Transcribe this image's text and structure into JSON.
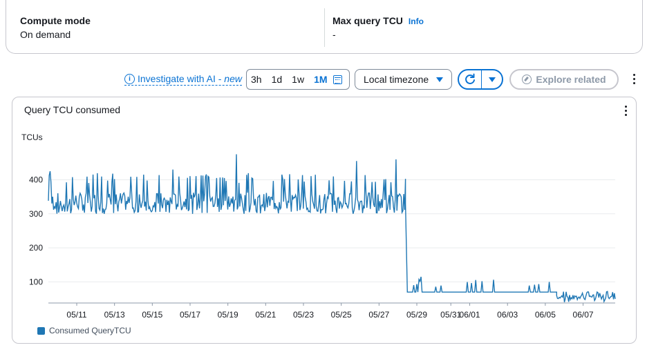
{
  "summary": {
    "compute_mode": {
      "label": "Compute mode",
      "value": "On demand"
    },
    "max_query_tcu": {
      "label": "Max query TCU",
      "info": "Info",
      "value": "-"
    }
  },
  "toolbar": {
    "investigate_label": "Investigate with AI - ",
    "investigate_new": "new",
    "ranges": [
      "3h",
      "1d",
      "1w",
      "1M"
    ],
    "selected_range": "1M",
    "timezone": "Local timezone",
    "explore_label": "Explore related"
  },
  "chart": {
    "title": "Query TCU consumed",
    "y_unit": "TCUs",
    "legend": "Consumed QueryTCU",
    "color": "#1f77b4"
  },
  "chart_data": {
    "type": "line",
    "title": "Query TCU consumed",
    "ylabel": "TCUs",
    "xlabel": "",
    "ylim": [
      38,
      480
    ],
    "yticks": [
      100,
      200,
      300,
      400
    ],
    "x_tick_labels": [
      "05/11",
      "05/13",
      "05/15",
      "05/17",
      "05/19",
      "05/21",
      "05/23",
      "05/25",
      "05/27",
      "05/29",
      "05/31",
      "06/01",
      "06/03",
      "06/05",
      "06/07"
    ],
    "x_tick_days": [
      1.5,
      3.5,
      5.5,
      7.5,
      9.5,
      11.5,
      13.5,
      15.5,
      17.5,
      19.5,
      21.3,
      22.3,
      24.3,
      26.3,
      28.3
    ],
    "x_range_days": [
      0,
      30
    ],
    "legend_position": "bottom-left",
    "grid": "horizontal",
    "series": [
      {
        "name": "Consumed QueryTCU",
        "segments": [
          {
            "from_day": 0,
            "to_day": 18.9,
            "base": 335,
            "low": 300,
            "high": 420,
            "style": "noisy"
          },
          {
            "from_day": 18.9,
            "to_day": 19.0,
            "base": 330,
            "low": 70,
            "high": 330,
            "style": "drop"
          },
          {
            "from_day": 19.0,
            "to_day": 26.9,
            "base": 70,
            "low": 68,
            "high": 110,
            "style": "spiky"
          },
          {
            "from_day": 26.9,
            "to_day": 30,
            "base": 55,
            "low": 40,
            "high": 72,
            "style": "noisy"
          }
        ],
        "peaks": [
          {
            "day": 9.95,
            "value": 475
          },
          {
            "day": 16.3,
            "value": 455
          },
          {
            "day": 18.4,
            "value": 460
          },
          {
            "day": 0.1,
            "value": 425
          },
          {
            "day": 6.6,
            "value": 430
          },
          {
            "day": 19.7,
            "value": 115
          },
          {
            "day": 26.5,
            "value": 100
          }
        ]
      }
    ]
  }
}
